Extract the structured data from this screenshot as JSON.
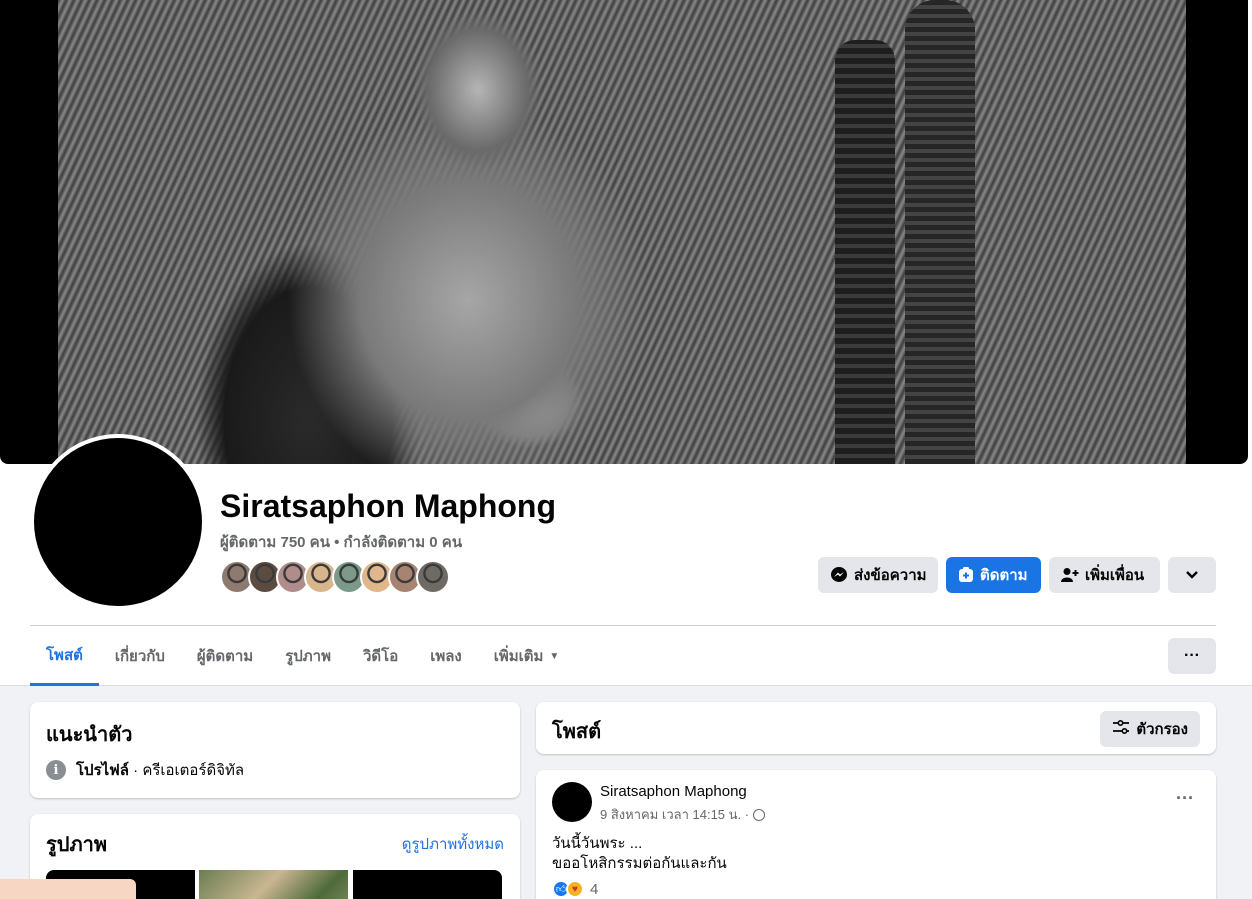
{
  "profile": {
    "name": "Siratsaphon Maphong",
    "stats": "ผู้ติดตาม 750 คน • กำลังติดตาม 0 คน",
    "friend_avatar_colors": [
      "#8e7a6e",
      "#5b4b40",
      "#b08c8a",
      "#d9b58c",
      "#7b9a8a",
      "#e0b68a",
      "#a68471",
      "#6e6a64"
    ]
  },
  "actions": {
    "message_label": "ส่งข้อความ",
    "follow_label": "ติดตาม",
    "add_friend_label": "เพิ่มเพื่อน",
    "more_icon": "chevron-down-icon"
  },
  "tabs": [
    {
      "label": "โพสต์",
      "active": true
    },
    {
      "label": "เกี่ยวกับ",
      "active": false
    },
    {
      "label": "ผู้ติดตาม",
      "active": false
    },
    {
      "label": "รูปภาพ",
      "active": false
    },
    {
      "label": "วิดีโอ",
      "active": false
    },
    {
      "label": "เพลง",
      "active": false
    },
    {
      "label": "เพิ่มเติม",
      "active": false
    }
  ],
  "intro": {
    "title": "แนะนำตัว",
    "profile_label": "โปรไฟล์",
    "profile_sub": " · ครีเอเตอร์ดิจิทัล"
  },
  "photos": {
    "title": "รูปภาพ",
    "see_all": "ดูรูปภาพทั้งหมด"
  },
  "posts": {
    "title": "โพสต์",
    "filter_label": "ตัวกรอง",
    "items": [
      {
        "author": "Siratsaphon Maphong",
        "meta": "9 สิงหาคม เวลา 14:15 น. ·",
        "line1": "วันนี้วันพระ ...",
        "line2": "ขออโหสิกรรมต่อกันและกัน",
        "reaction_count": "4"
      }
    ]
  },
  "colors": {
    "accent": "#1b74e4",
    "background": "#f0f2f5",
    "secondary_text": "#65676b"
  }
}
